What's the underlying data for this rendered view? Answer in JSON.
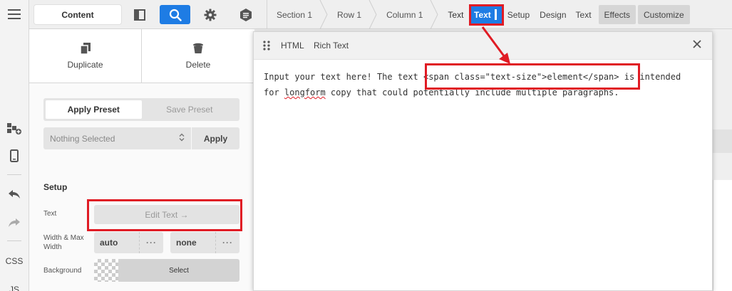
{
  "rail": {
    "css_label": "CSS",
    "js_label": "JS"
  },
  "topbar": {
    "content_tab": "Content",
    "breadcrumbs": [
      "Section 1",
      "Row 1",
      "Column 1",
      "Text"
    ],
    "modes": {
      "active": "Text",
      "setup": "Setup",
      "design": "Design",
      "text": "Text",
      "effects": "Effects",
      "customize": "Customize"
    }
  },
  "panel": {
    "duplicate": "Duplicate",
    "delete": "Delete",
    "apply_preset": "Apply Preset",
    "save_preset": "Save Preset",
    "preset_select": "Nothing Selected",
    "apply": "Apply",
    "setup_title": "Setup",
    "text_label": "Text",
    "edit_text": "Edit Text →",
    "width_label": "Width & Max Width",
    "width_value": "auto",
    "max_width_value": "none",
    "dots": "···",
    "background_label": "Background",
    "background_select": "Select"
  },
  "editor": {
    "tab_html": "HTML",
    "tab_rich": "Rich Text",
    "line1_pre": "Input your text here! The text ",
    "line1_code": "<span class=\"text-size\">element</span>",
    "line1_post": " is intended",
    "line2_pre": "for ",
    "line2_word": "longform",
    "line2_post": " copy that could potentially include multiple paragraphs."
  },
  "colors": {
    "accent": "#1e7ce4",
    "highlight": "#e01b24"
  }
}
